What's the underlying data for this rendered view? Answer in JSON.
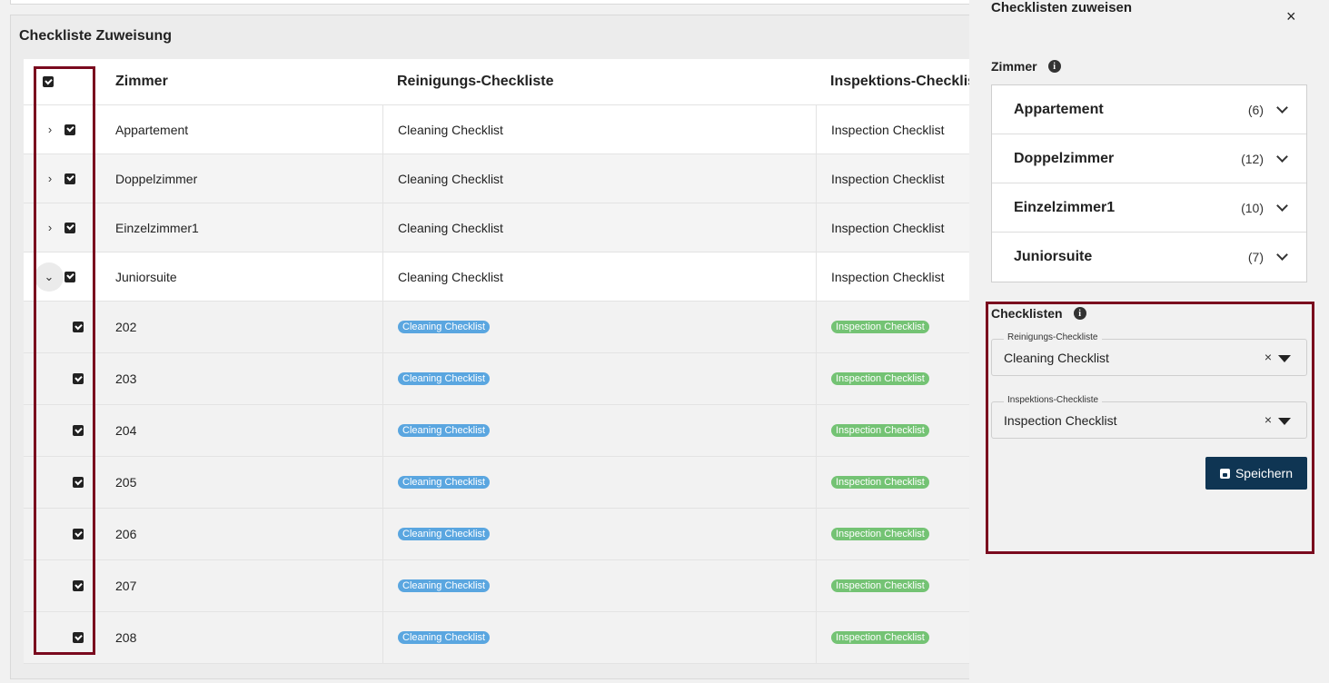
{
  "card": {
    "title": "Checkliste Zuweisung"
  },
  "table": {
    "headers": {
      "zimmer": "Zimmer",
      "reinigung": "Reinigungs-Checkliste",
      "inspektion": "Inspektions-Checklist"
    },
    "groups": [
      {
        "name": "Appartement",
        "reinigung": "Cleaning Checklist",
        "inspektion": "Inspection Checklist",
        "expanded": false
      },
      {
        "name": "Doppelzimmer",
        "reinigung": "Cleaning Checklist",
        "inspektion": "Inspection Checklist",
        "expanded": false
      },
      {
        "name": "Einzelzimmer1",
        "reinigung": "Cleaning Checklist",
        "inspektion": "Inspection Checklist",
        "expanded": false
      },
      {
        "name": "Juniorsuite",
        "reinigung": "Cleaning Checklist",
        "inspektion": "Inspection Checklist",
        "expanded": true
      }
    ],
    "rooms": [
      {
        "number": "202",
        "reinigung": "Cleaning Checklist",
        "inspektion": "Inspection Checklist"
      },
      {
        "number": "203",
        "reinigung": "Cleaning Checklist",
        "inspektion": "Inspection Checklist"
      },
      {
        "number": "204",
        "reinigung": "Cleaning Checklist",
        "inspektion": "Inspection Checklist"
      },
      {
        "number": "205",
        "reinigung": "Cleaning Checklist",
        "inspektion": "Inspection Checklist"
      },
      {
        "number": "206",
        "reinigung": "Cleaning Checklist",
        "inspektion": "Inspection Checklist"
      },
      {
        "number": "207",
        "reinigung": "Cleaning Checklist",
        "inspektion": "Inspection Checklist"
      },
      {
        "number": "208",
        "reinigung": "Cleaning Checklist",
        "inspektion": "Inspection Checklist"
      }
    ]
  },
  "panel": {
    "title": "Checklisten zuweisen",
    "close": "×",
    "zimmer_label": "Zimmer",
    "accordion": [
      {
        "name": "Appartement",
        "count": "(6)"
      },
      {
        "name": "Doppelzimmer",
        "count": "(12)"
      },
      {
        "name": "Einzelzimmer1",
        "count": "(10)"
      },
      {
        "name": "Juniorsuite",
        "count": "(7)"
      }
    ],
    "checklisten_label": "Checklisten",
    "reinigung_field": {
      "legend": "Reinigungs-Checkliste",
      "value": "Cleaning Checklist",
      "clear": "×"
    },
    "inspektion_field": {
      "legend": "Inspektions-Checkliste",
      "value": "Inspection Checklist",
      "clear": "×"
    },
    "save_label": "Speichern"
  },
  "colors": {
    "accent": "#0f3553",
    "highlight": "#7a0a1e",
    "badge_blue": "#5aa6e0",
    "badge_green": "#74c374"
  }
}
